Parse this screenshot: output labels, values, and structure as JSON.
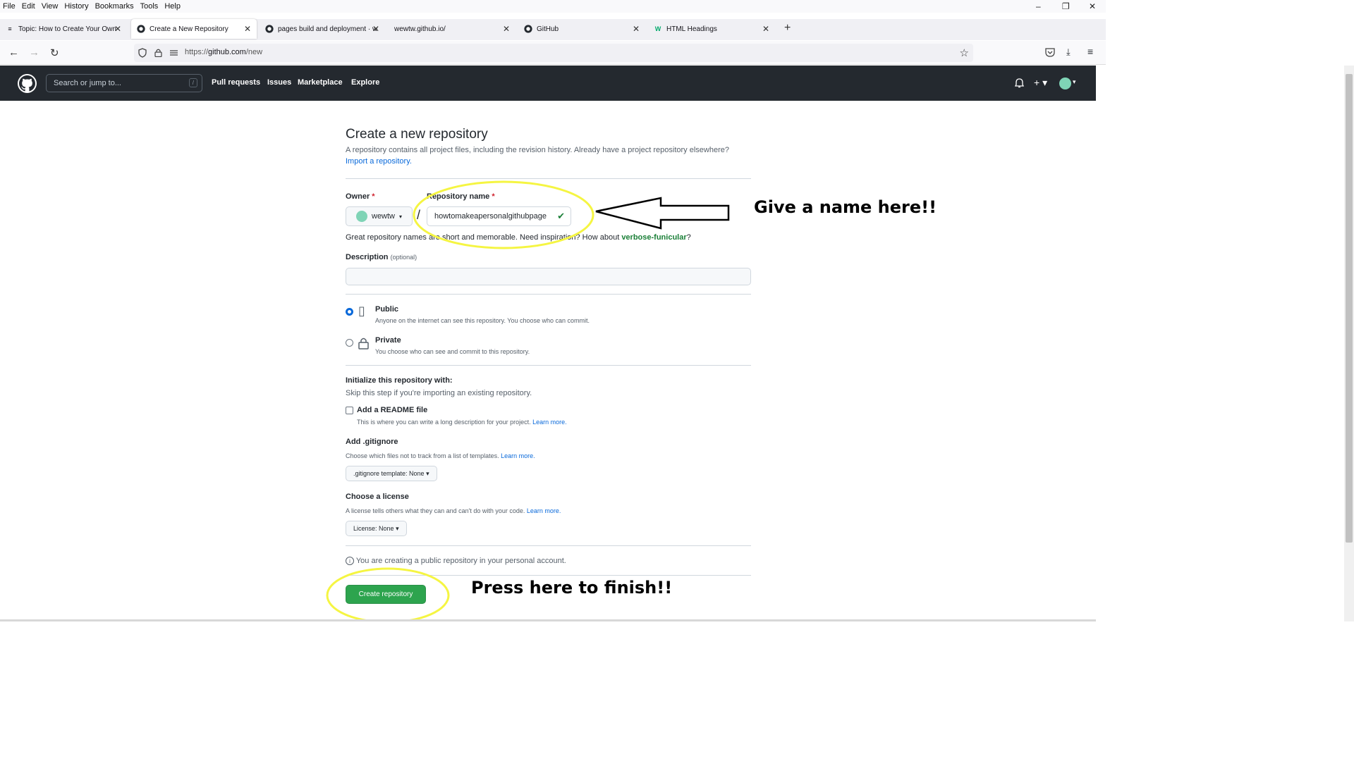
{
  "browser": {
    "menu": [
      "File",
      "Edit",
      "View",
      "History",
      "Bookmarks",
      "Tools",
      "Help"
    ],
    "window_controls": {
      "minimize": "–",
      "restore": "❐",
      "close": "✕"
    },
    "tabs": [
      {
        "title": "Topic: How to Create Your Own",
        "icon": "forum-icon"
      },
      {
        "title": "Create a New Repository",
        "icon": "github-icon"
      },
      {
        "title": "pages build and deployment · w",
        "icon": "github-icon"
      },
      {
        "title": "wewtw.github.io/",
        "icon": "none"
      },
      {
        "title": "GitHub",
        "icon": "github-icon"
      },
      {
        "title": "HTML Headings",
        "icon": "w3schools-icon"
      }
    ],
    "new_tab": "+",
    "url_prefix": "https://",
    "url_host": "github.com",
    "url_path": "/new"
  },
  "github": {
    "search_placeholder": "Search or jump to...",
    "search_key": "/",
    "nav": [
      "Pull requests",
      "Issues",
      "Marketplace",
      "Explore"
    ]
  },
  "form": {
    "title": "Create a new repository",
    "subtitle": "A repository contains all project files, including the revision history. Already have a project repository elsewhere?",
    "import_link": "Import a repository.",
    "owner_label": "Owner",
    "required_mark": "*",
    "owner_value": "wewtw",
    "repo_label": "Repository name",
    "repo_value": "howtomakeapersonalgithubpage",
    "hint_prefix": "Great repository names are short and memorable. Need inspiration? How about ",
    "hint_suggestion": "verbose-funicular",
    "hint_suffix": "?",
    "description_label": "Description",
    "description_optional": "(optional)",
    "public_title": "Public",
    "public_desc": "Anyone on the internet can see this repository. You choose who can commit.",
    "private_title": "Private",
    "private_desc": "You choose who can see and commit to this repository.",
    "visibility_selected": "Public",
    "init_title": "Initialize this repository with:",
    "init_sub": "Skip this step if you're importing an existing repository.",
    "readme_label": "Add a README file",
    "readme_desc": "This is where you can write a long description for your project.",
    "learn_more": "Learn more.",
    "readme_checked": false,
    "gitignore_label": "Add .gitignore",
    "gitignore_desc": "Choose which files not to track from a list of templates.",
    "gitignore_select": ".gitignore template: None",
    "license_label": "Choose a license",
    "license_desc": "A license tells others what they can and can't do with your code.",
    "license_select": "License: None",
    "notice": "You are creating a public repository in your personal account.",
    "create_button": "Create repository"
  },
  "annotations": {
    "name_hint": "Give a name here!!",
    "finish_hint": "Press here to finish!!",
    "highlight_color": "#f5f542"
  }
}
